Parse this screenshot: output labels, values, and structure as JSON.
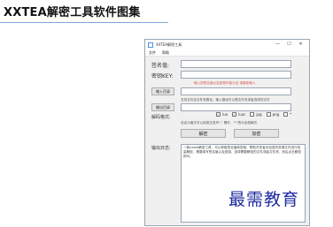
{
  "page": {
    "title": "XXTEA解密工具软件图集"
  },
  "window": {
    "title": "XXTEA解密工具",
    "controls": {
      "minimize": "—",
      "maximize": "☐",
      "close": "✕"
    }
  },
  "menu": {
    "items": [
      "文件",
      "帮助"
    ]
  },
  "form": {
    "sign_label": "签名值:",
    "sign_value": "",
    "key_label": "密钥KEY:",
    "key_value": "",
    "key_hint": "输入的签名值以及密钥不能为空,请重新输入",
    "input_dir_button": "输入目录",
    "input_dir_value": "",
    "same_dir_hint": "支持文件及文件夹路径，输入路径可以是文件夹或者选择的文件",
    "output_dir_button": "输出目录",
    "output_dir_value": "",
    "decrypt_format_label": "解码格式:",
    "options": [
      {
        "label": "lua",
        "checked": true
      },
      {
        "label": "luac",
        "checked": true
      },
      {
        "label": "jpg",
        "checked": false
      },
      {
        "label": "png",
        "checked": false
      },
      {
        "label": "*",
        "checked": false
      }
    ],
    "custom_hint": "自定义格式可以用英文逗号\",\" 隔开，\"*\"表示全部格式",
    "decrypt_button": "解密",
    "encrypt_button": "加密",
    "log_label": "输出日志:",
    "log_text": "一款xxtea解密工具，可以获取签名值和密钥，帮助开发者对加密的资源文件进行批量解密，需要填写签名值以及密钥，选择需要解密的文件或者文件夹，然后点击解密即可。"
  },
  "watermark": "最需教育"
}
